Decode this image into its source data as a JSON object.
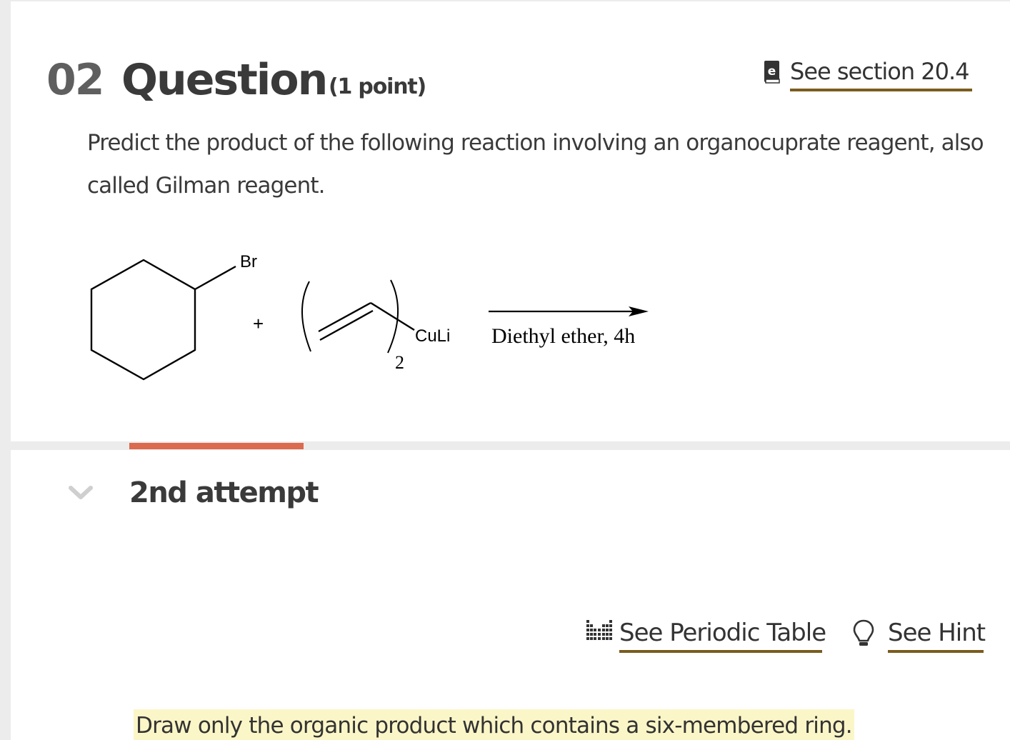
{
  "question": {
    "number": "02",
    "title": "Question",
    "points": "(1 point)",
    "section_link": "See section 20.4",
    "prompt": "Predict the product of the following reaction involving an organocuprate reagent, also called Gilman reagent."
  },
  "reaction": {
    "reactant1_label": "Br",
    "plus": "+",
    "reagent_label": "CuLi",
    "reagent_subscript": "2",
    "conditions": "Diethyl ether, 4h"
  },
  "attempt": {
    "label": "2nd attempt"
  },
  "tools": {
    "periodic_table_label": "See Periodic Table",
    "hint_label": "See Hint"
  },
  "instruction": "Draw only the organic product which contains a six-membered ring.",
  "icons": {
    "book": "ebook-icon",
    "periodic": "periodic-table-icon",
    "hint": "lightbulb-icon",
    "chevron": "chevron-down-icon"
  },
  "colors": {
    "accent_underline": "#7a5c1e",
    "attempt_bar": "#dc6a4e",
    "highlight": "#fbf6c7"
  }
}
